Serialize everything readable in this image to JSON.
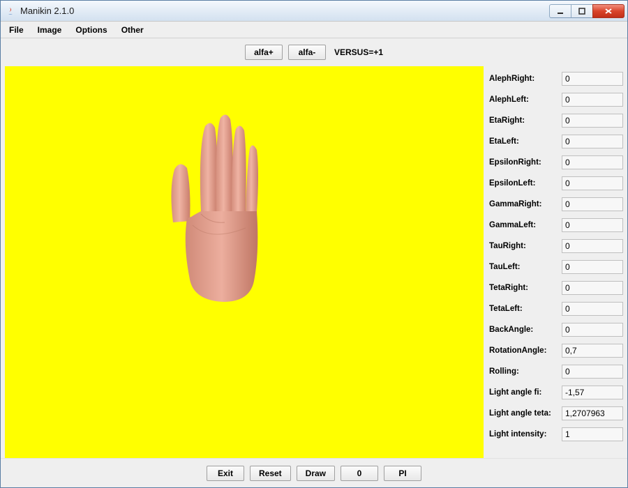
{
  "window": {
    "title": "Manikin 2.1.0"
  },
  "menubar": {
    "items": [
      "File",
      "Image",
      "Options",
      "Other"
    ]
  },
  "top": {
    "alfa_plus": "alfa+",
    "alfa_minus": "alfa-",
    "versus": "VERSUS=+1"
  },
  "properties": [
    {
      "label": "AlephRight:",
      "value": "0"
    },
    {
      "label": "AlephLeft:",
      "value": "0"
    },
    {
      "label": "EtaRight:",
      "value": "0"
    },
    {
      "label": "EtaLeft:",
      "value": "0"
    },
    {
      "label": "EpsilonRight:",
      "value": "0"
    },
    {
      "label": "EpsilonLeft:",
      "value": "0"
    },
    {
      "label": "GammaRight:",
      "value": "0"
    },
    {
      "label": "GammaLeft:",
      "value": "0"
    },
    {
      "label": "TauRight:",
      "value": "0"
    },
    {
      "label": "TauLeft:",
      "value": "0"
    },
    {
      "label": "TetaRight:",
      "value": "0"
    },
    {
      "label": "TetaLeft:",
      "value": "0"
    },
    {
      "label": "BackAngle:",
      "value": "0"
    },
    {
      "label": "RotationAngle:",
      "value": "0,7"
    },
    {
      "label": "Rolling:",
      "value": "0"
    },
    {
      "label": "Light angle fi:",
      "value": "-1,57"
    },
    {
      "label": "Light angle teta:",
      "value": "1,2707963"
    },
    {
      "label": "Light intensity:",
      "value": "1"
    }
  ],
  "bottom": {
    "exit": "Exit",
    "reset": "Reset",
    "draw": "Draw",
    "zero": "0",
    "pi": "PI"
  },
  "colors": {
    "canvas_bg": "#ffff00",
    "hand_fill": "#e8a696"
  }
}
